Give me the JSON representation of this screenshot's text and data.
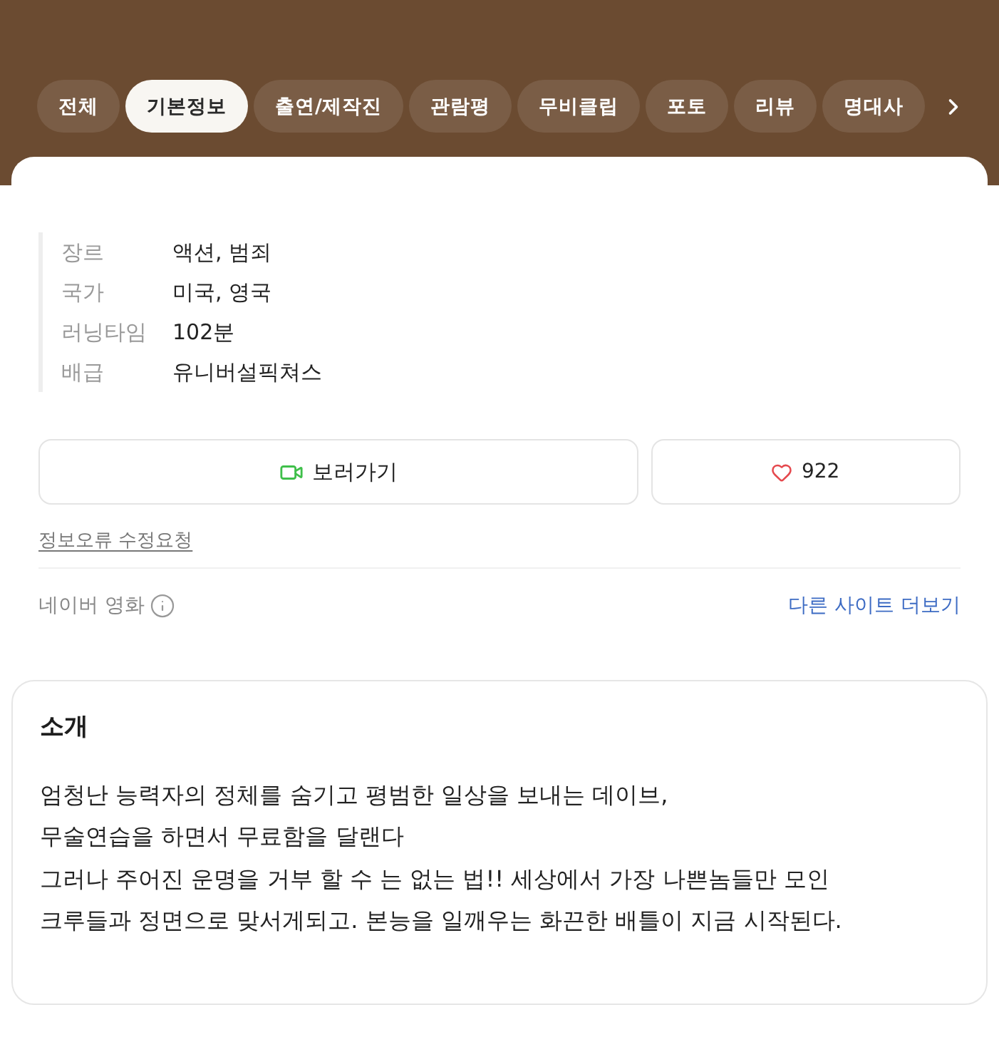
{
  "tabs": [
    {
      "label": "전체",
      "selected": false
    },
    {
      "label": "기본정보",
      "selected": true
    },
    {
      "label": "출연/제작진",
      "selected": false
    },
    {
      "label": "관람평",
      "selected": false
    },
    {
      "label": "무비클립",
      "selected": false
    },
    {
      "label": "포토",
      "selected": false
    },
    {
      "label": "리뷰",
      "selected": false
    },
    {
      "label": "명대사",
      "selected": false
    }
  ],
  "info": [
    {
      "label": "장르",
      "value": "액션, 범죄"
    },
    {
      "label": "국가",
      "value": "미국, 영국"
    },
    {
      "label": "러닝타임",
      "value": "102분"
    },
    {
      "label": "배급",
      "value": "유니버설픽쳐스"
    }
  ],
  "actions": {
    "watch": "보러가기",
    "likes": "922"
  },
  "report_link": "정보오류 수정요청",
  "footer": {
    "source": "네이버 영화",
    "more_link": "다른 사이트 더보기"
  },
  "intro": {
    "title": "소개",
    "text": "엄청난 능력자의 정체를 숨기고 평범한 일상을 보내는 데이브,\n무술연습을 하면서 무료함을 달랜다\n그러나 주어진 운명을 거부 할 수 는 없는 법!! 세상에서 가장 나쁜놈들만 모인\n크루들과 정면으로 맞서게되고. 본능을 일깨우는 화끈한 배틀이 지금 시작된다."
  }
}
